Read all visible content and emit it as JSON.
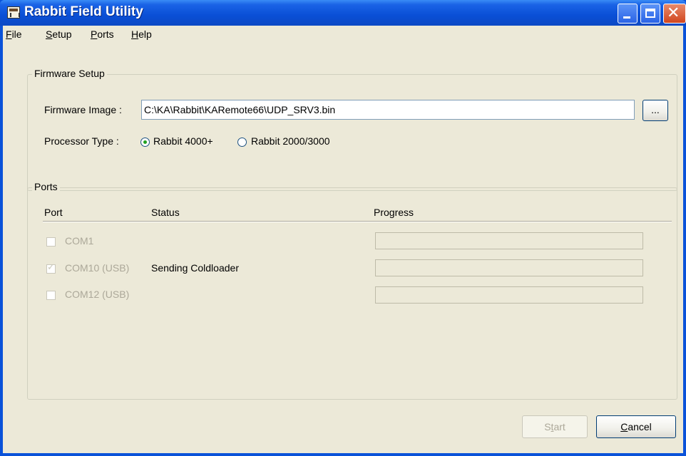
{
  "window": {
    "title": "Rabbit Field Utility"
  },
  "menu": [
    {
      "accel": "F",
      "rest": "ile"
    },
    {
      "accel": "S",
      "rest": "etup"
    },
    {
      "accel": "P",
      "rest": "orts"
    },
    {
      "accel": "H",
      "rest": "elp"
    }
  ],
  "firmware": {
    "group_label": "Firmware Setup",
    "image_label": "Firmware Image :",
    "image_value": "C:\\KA\\Rabbit\\KARemote66\\UDP_SRV3.bin",
    "browse_label": "...",
    "processor_label": "Processor Type :",
    "options": [
      "Rabbit 4000+",
      "Rabbit 2000/3000"
    ],
    "selected": "Rabbit 4000+"
  },
  "ports": {
    "group_label": "Ports",
    "columns": [
      "Port",
      "Status",
      "Progress"
    ],
    "rows": [
      {
        "port": "COM1",
        "checked": false,
        "status": "",
        "progress": 0
      },
      {
        "port": "COM10 (USB)",
        "checked": true,
        "status": "Sending Coldloader",
        "progress": 0
      },
      {
        "port": "COM12 (USB)",
        "checked": false,
        "status": "",
        "progress": 0
      }
    ]
  },
  "buttons": {
    "start_accel_prefix": "S",
    "start_accel": "t",
    "start_rest": "art",
    "cancel_accel": "C",
    "cancel_rest": "ancel"
  },
  "colors": {
    "titlebar": "#0a52d9",
    "dialog": "#ece9d8",
    "radio_dot": "#21a121",
    "disabled": "#aca899"
  }
}
